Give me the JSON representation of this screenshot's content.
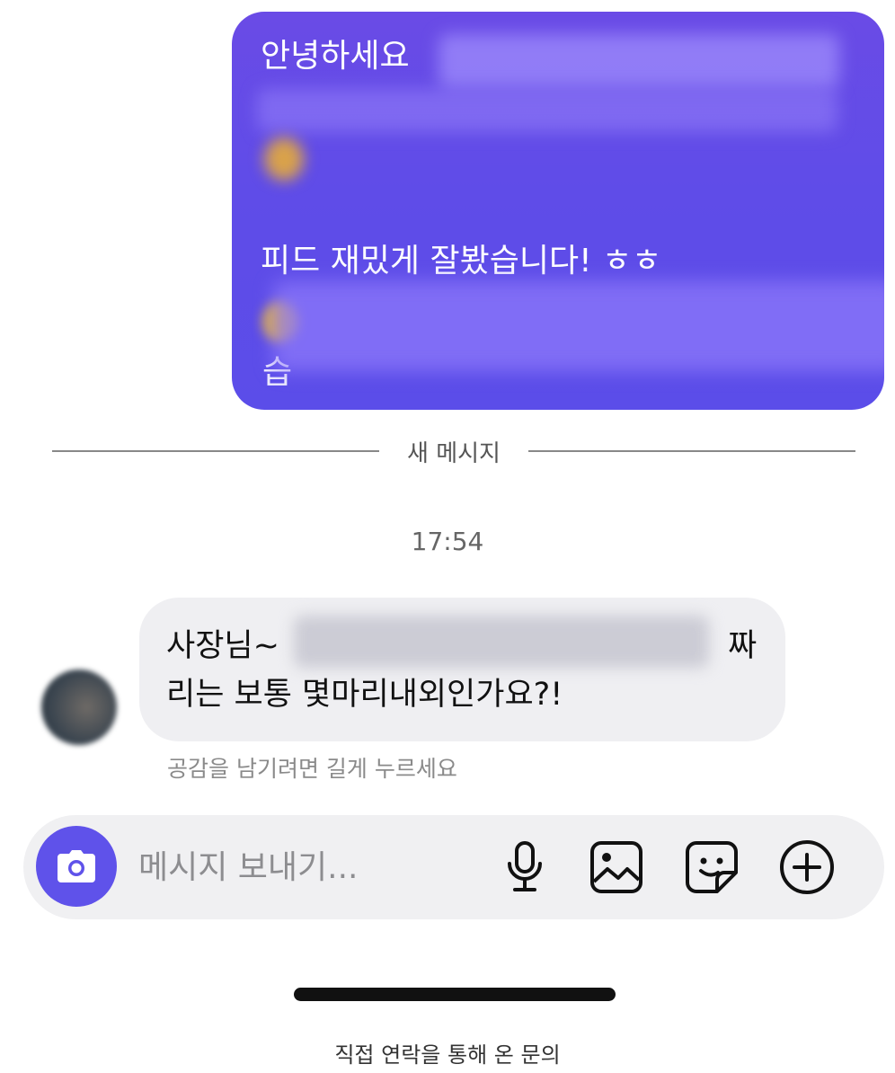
{
  "outgoing_message": {
    "line1": "안녕하세요",
    "line2": "피드 재밌게 잘봤습니다! ㅎㅎ",
    "line3_partial": "습"
  },
  "divider": {
    "label": "새 메시지"
  },
  "timestamp": "17:54",
  "incoming_message": {
    "line1_start": "사장님~",
    "line1_end": "짜",
    "line2": "리는 보통 몇마리내외인가요?!"
  },
  "reaction_hint": "공감을 남기려면 길게 누르세요",
  "composer": {
    "placeholder": "메시지 보내기...",
    "accent_color": "#5f52ea",
    "icons": [
      "camera-icon",
      "microphone-icon",
      "gallery-icon",
      "sticker-icon",
      "add-icon"
    ]
  },
  "caption": "직접 연락을 통해 온 문의"
}
